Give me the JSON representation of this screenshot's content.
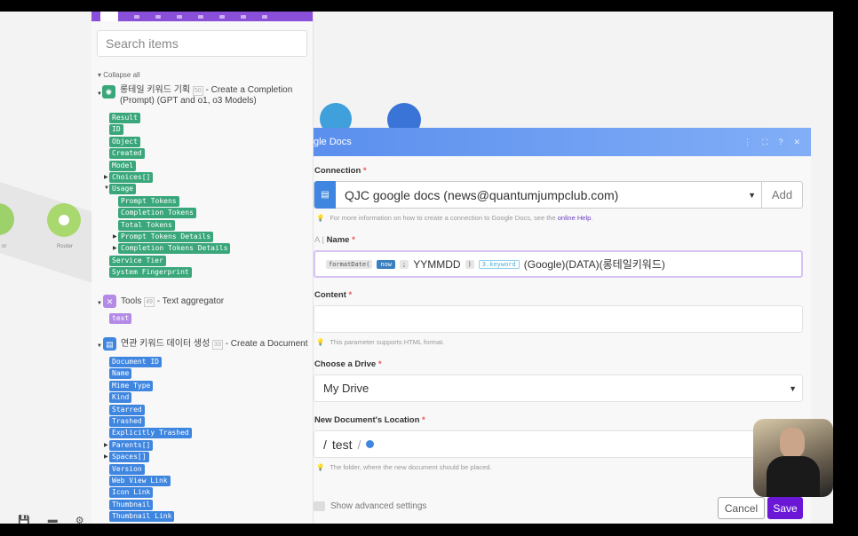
{
  "left_panel": {
    "search_placeholder": "Search items",
    "collapse_all": "Collapse all",
    "modules": [
      {
        "name": "롱테일 키워드 기획",
        "id": "50",
        "action": "- Create a Completion (Prompt) (GPT and o1, o3 Models)",
        "icon": "openai-icon",
        "color": "#3aa77b"
      },
      {
        "name": "Tools",
        "id": "49",
        "action": "- Text aggregator",
        "icon": "tools-icon",
        "color": "#b38ae6"
      },
      {
        "name": "연관 키워드 데이터 생성",
        "id": "33",
        "action": "- Create a Document",
        "icon": "google-docs-icon",
        "color": "#3f86e0"
      }
    ],
    "completion_items": [
      "Result",
      "ID",
      "Object",
      "Created",
      "Model",
      "Choices[]",
      "Usage"
    ],
    "usage_items": [
      "Prompt Tokens",
      "Completion Tokens",
      "Total Tokens",
      "Prompt Tokens Details",
      "Completion Tokens Details"
    ],
    "completion_items_after": [
      "Service Tier",
      "System Fingerprint"
    ],
    "tools_items": [
      "text"
    ],
    "document_items": [
      "Document ID",
      "Name",
      "Mime Type",
      "Kind",
      "Starred",
      "Trashed",
      "Explicitly Trashed",
      "Parents[]",
      "Spaces[]",
      "Version",
      "Web View Link",
      "Icon Link",
      "Thumbnail",
      "Thumbnail Link"
    ]
  },
  "canvas": {
    "node_labels": [
      "or",
      "Router"
    ]
  },
  "modal": {
    "title": "gle Docs",
    "connection_label": "Connection",
    "connection_value": "QJC google docs (news@quantumjumpclub.com)",
    "add_label": "Add",
    "connection_hint": "For more information on how to create a connection to Google Docs, see the",
    "connection_hint_link": "online Help",
    "name_label": "Name",
    "name_value": {
      "fn": "formatDate(",
      "now": "now",
      "sep": ";",
      "format": "YYMMDD",
      "close": ")",
      "keyword": "3.keyword",
      "text": "(Google)(DATA)(롱테일키워드)"
    },
    "content_label": "Content",
    "content_value": "",
    "content_hint": "This parameter supports HTML format.",
    "drive_label": "Choose a Drive",
    "drive_value": "My Drive",
    "location_label": "New Document's Location",
    "location_path": [
      "/",
      "test",
      "/"
    ],
    "location_hint": "The folder, where the new document should be placed.",
    "advanced_label": "Show advanced settings",
    "cancel_label": "Cancel",
    "save_label": "Save"
  }
}
